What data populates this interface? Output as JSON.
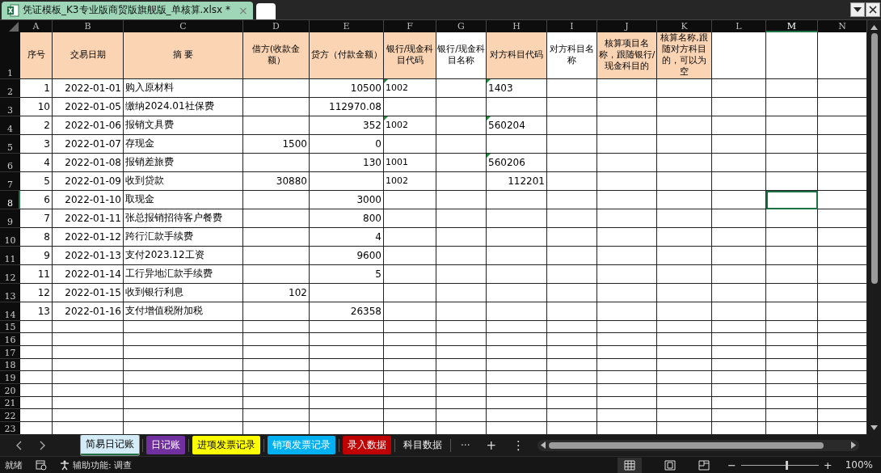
{
  "window": {
    "file_tab": "凭证模板_K3专业版商贸版旗舰版_单核算.xlsx *",
    "close": "×"
  },
  "header_row_number": "1",
  "columns": [
    {
      "letter": "A",
      "header": "序号",
      "color": "#fbd4b4",
      "selected": false
    },
    {
      "letter": "B",
      "header": "交易日期",
      "color": "#fbd4b4",
      "selected": false
    },
    {
      "letter": "C",
      "header": "摘  要",
      "color": "#fbd4b4",
      "selected": false
    },
    {
      "letter": "D",
      "header": "借方(收款金额）",
      "color": "#fbd4b4",
      "selected": false
    },
    {
      "letter": "E",
      "header": "贷方（付款金额）",
      "color": "#fbd4b4",
      "selected": false
    },
    {
      "letter": "F",
      "header": "银行/现金科目代码",
      "color": "#fbd4b4",
      "selected": false
    },
    {
      "letter": "G",
      "header": "银行/现金科目名称",
      "color": "#ffffff",
      "selected": false
    },
    {
      "letter": "H",
      "header": "对方科目代码",
      "color": "#fbd4b4",
      "selected": false
    },
    {
      "letter": "I",
      "header": "对方科目名称",
      "color": "#ffffff",
      "selected": false
    },
    {
      "letter": "J",
      "header": "核算项目名称，跟随银行/现金科目的",
      "color": "#fbd4b4",
      "selected": false
    },
    {
      "letter": "K",
      "header": "核算名称,跟随对方科目的，可以为空",
      "color": "#fbd4b4",
      "selected": false
    },
    {
      "letter": "L",
      "selected": false
    },
    {
      "letter": "M",
      "selected": true
    },
    {
      "letter": "N",
      "selected": false
    }
  ],
  "rows": [
    {
      "number": "2",
      "cells": {
        "A": "1",
        "B": "2022-01-01",
        "C": "购入原材料",
        "E": "10500",
        "F": "1002",
        "H": "1403"
      },
      "bank_code_flag": true,
      "counter_code_flag": true
    },
    {
      "number": "3",
      "cells": {
        "A": "10",
        "B": "2022-01-05",
        "C": "缴纳2024.01社保费",
        "E": "112970.08"
      }
    },
    {
      "number": "4",
      "cells": {
        "A": "2",
        "B": "2022-01-06",
        "C": "报销文具费",
        "E": "352",
        "F": "1002",
        "H": "560204"
      },
      "bank_code_flag": true,
      "counter_code_flag": true
    },
    {
      "number": "5",
      "cells": {
        "A": "3",
        "B": "2022-01-07",
        "C": "存现金",
        "D": "1500",
        "E": "0"
      }
    },
    {
      "number": "6",
      "cells": {
        "A": "4",
        "B": "2022-01-08",
        "C": "报销差旅费",
        "E": "130",
        "F": "1001",
        "H": "560206"
      },
      "counter_code_flag": true
    },
    {
      "number": "7",
      "cells": {
        "A": "5",
        "B": "2022-01-09",
        "C": "收到贷款",
        "D": "30880",
        "F": "1002",
        "H": "112201"
      },
      "counter_code_numeric": true
    },
    {
      "number": "8",
      "cells": {
        "A": "6",
        "B": "2022-01-10",
        "C": "取现金",
        "E": "3000"
      },
      "selected": true
    },
    {
      "number": "9",
      "cells": {
        "A": "7",
        "B": "2022-01-11",
        "C": "张总报销招待客户餐费",
        "E": "800"
      }
    },
    {
      "number": "10",
      "cells": {
        "A": "8",
        "B": "2022-01-12",
        "C": "跨行汇款手续费",
        "E": "4"
      }
    },
    {
      "number": "11",
      "cells": {
        "A": "9",
        "B": "2022-01-13",
        "C": "支付2023.12工资",
        "E": "9600"
      }
    },
    {
      "number": "12",
      "cells": {
        "A": "11",
        "B": "2022-01-14",
        "C": "工行异地汇款手续费",
        "E": "5"
      }
    },
    {
      "number": "13",
      "cells": {
        "A": "12",
        "B": "2022-01-15",
        "C": "收到银行利息",
        "D": "102"
      }
    },
    {
      "number": "14",
      "cells": {
        "A": "13",
        "B": "2022-01-16",
        "C": "支付增值税附加税",
        "E": "26358"
      }
    },
    {
      "number": "15",
      "cells": {}
    },
    {
      "number": "16",
      "cells": {}
    },
    {
      "number": "17",
      "cells": {}
    },
    {
      "number": "18",
      "cells": {}
    },
    {
      "number": "19",
      "cells": {}
    },
    {
      "number": "20",
      "cells": {}
    },
    {
      "number": "21",
      "cells": {}
    },
    {
      "number": "22",
      "cells": {}
    },
    {
      "number": "23",
      "cells": {}
    }
  ],
  "sheet_tabs": [
    {
      "label": "简易日记账",
      "color": "#d4ecf7",
      "selected": true
    },
    {
      "label": "日记账",
      "color": "#7030a0",
      "selected": false
    },
    {
      "label": "进项发票记录",
      "color": "#ffff00",
      "selected": false
    },
    {
      "label": "销项发票记录",
      "color": "#00b0f0",
      "selected": false
    },
    {
      "label": "录入数据",
      "color": "#c00000",
      "selected": false
    },
    {
      "label": "科目数据",
      "selected": false
    }
  ],
  "more_tabs": "···",
  "add_tab": "+",
  "tab_menu": "⋮",
  "status_bar": {
    "ready": "就绪",
    "accessibility": "辅助功能: 调查",
    "zoom": {
      "out": "−",
      "in": "+",
      "level": 0.57,
      "reading": "100%"
    }
  }
}
